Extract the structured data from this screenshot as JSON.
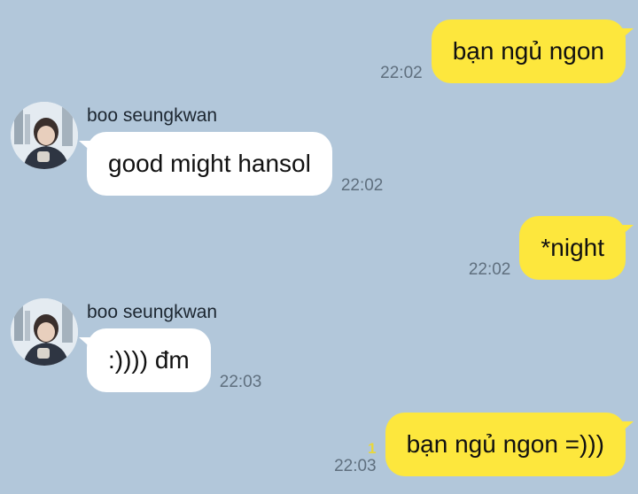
{
  "chat": {
    "messages": [
      {
        "direction": "out",
        "text": "bạn ngủ ngon",
        "time": "22:02",
        "unread": ""
      },
      {
        "direction": "in",
        "sender": "boo seungkwan",
        "text": "good might hansol",
        "time": "22:02"
      },
      {
        "direction": "out",
        "text": "*night",
        "time": "22:02",
        "unread": ""
      },
      {
        "direction": "in",
        "sender": "boo seungkwan",
        "text": ":)))) đm",
        "time": "22:03"
      },
      {
        "direction": "out",
        "text": "bạn ngủ ngon =)))",
        "time": "22:03",
        "unread": "1"
      }
    ]
  },
  "colors": {
    "background": "#b2c7da",
    "outgoing_bubble": "#fde73d",
    "incoming_bubble": "#ffffff",
    "timestamp": "#5f6f7e",
    "unread_count": "#e8d73b"
  },
  "icons": {
    "avatar": "profile-photo"
  }
}
